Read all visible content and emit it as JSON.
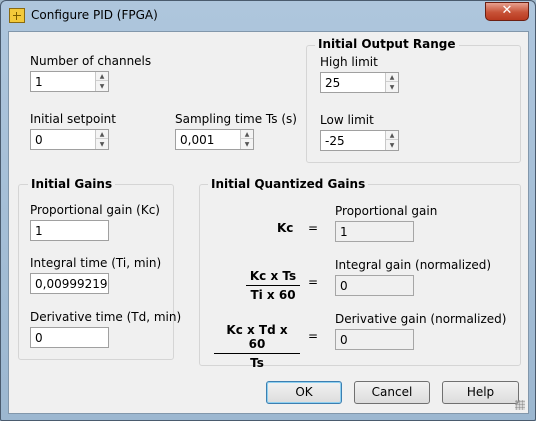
{
  "window": {
    "title": "Configure PID (FPGA)",
    "close_glyph": "✕"
  },
  "channels": {
    "label": "Number of channels",
    "value": "1"
  },
  "setpoint": {
    "label": "Initial setpoint",
    "value": "0"
  },
  "sampling": {
    "label": "Sampling time Ts (s)",
    "value": "0,001"
  },
  "output_range": {
    "title": "Initial Output Range",
    "high_label": "High limit",
    "high_value": "25",
    "low_label": "Low limit",
    "low_value": "-25"
  },
  "gains": {
    "title": "Initial Gains",
    "kc_label": "Proportional gain (Kc)",
    "kc_value": "1",
    "ti_label": "Integral time (Ti, min)",
    "ti_value": "0,00999219",
    "td_label": "Derivative time (Td, min)",
    "td_value": "0"
  },
  "quantized": {
    "title": "Initial Quantized Gains",
    "eq": "=",
    "kc_formula": "Kc",
    "i_num": "Kc x Ts",
    "i_den": "Ti x 60",
    "d_num": "Kc x Td x 60",
    "d_den": "Ts",
    "p_label": "Proportional gain",
    "p_value": "1",
    "i_label": "Integral gain (normalized)",
    "i_value": "0",
    "d_label": "Derivative gain (normalized)",
    "d_value": "0"
  },
  "buttons": {
    "ok": "OK",
    "cancel": "Cancel",
    "help": "Help"
  },
  "spinner_glyphs": {
    "up": "▲",
    "down": "▼"
  }
}
